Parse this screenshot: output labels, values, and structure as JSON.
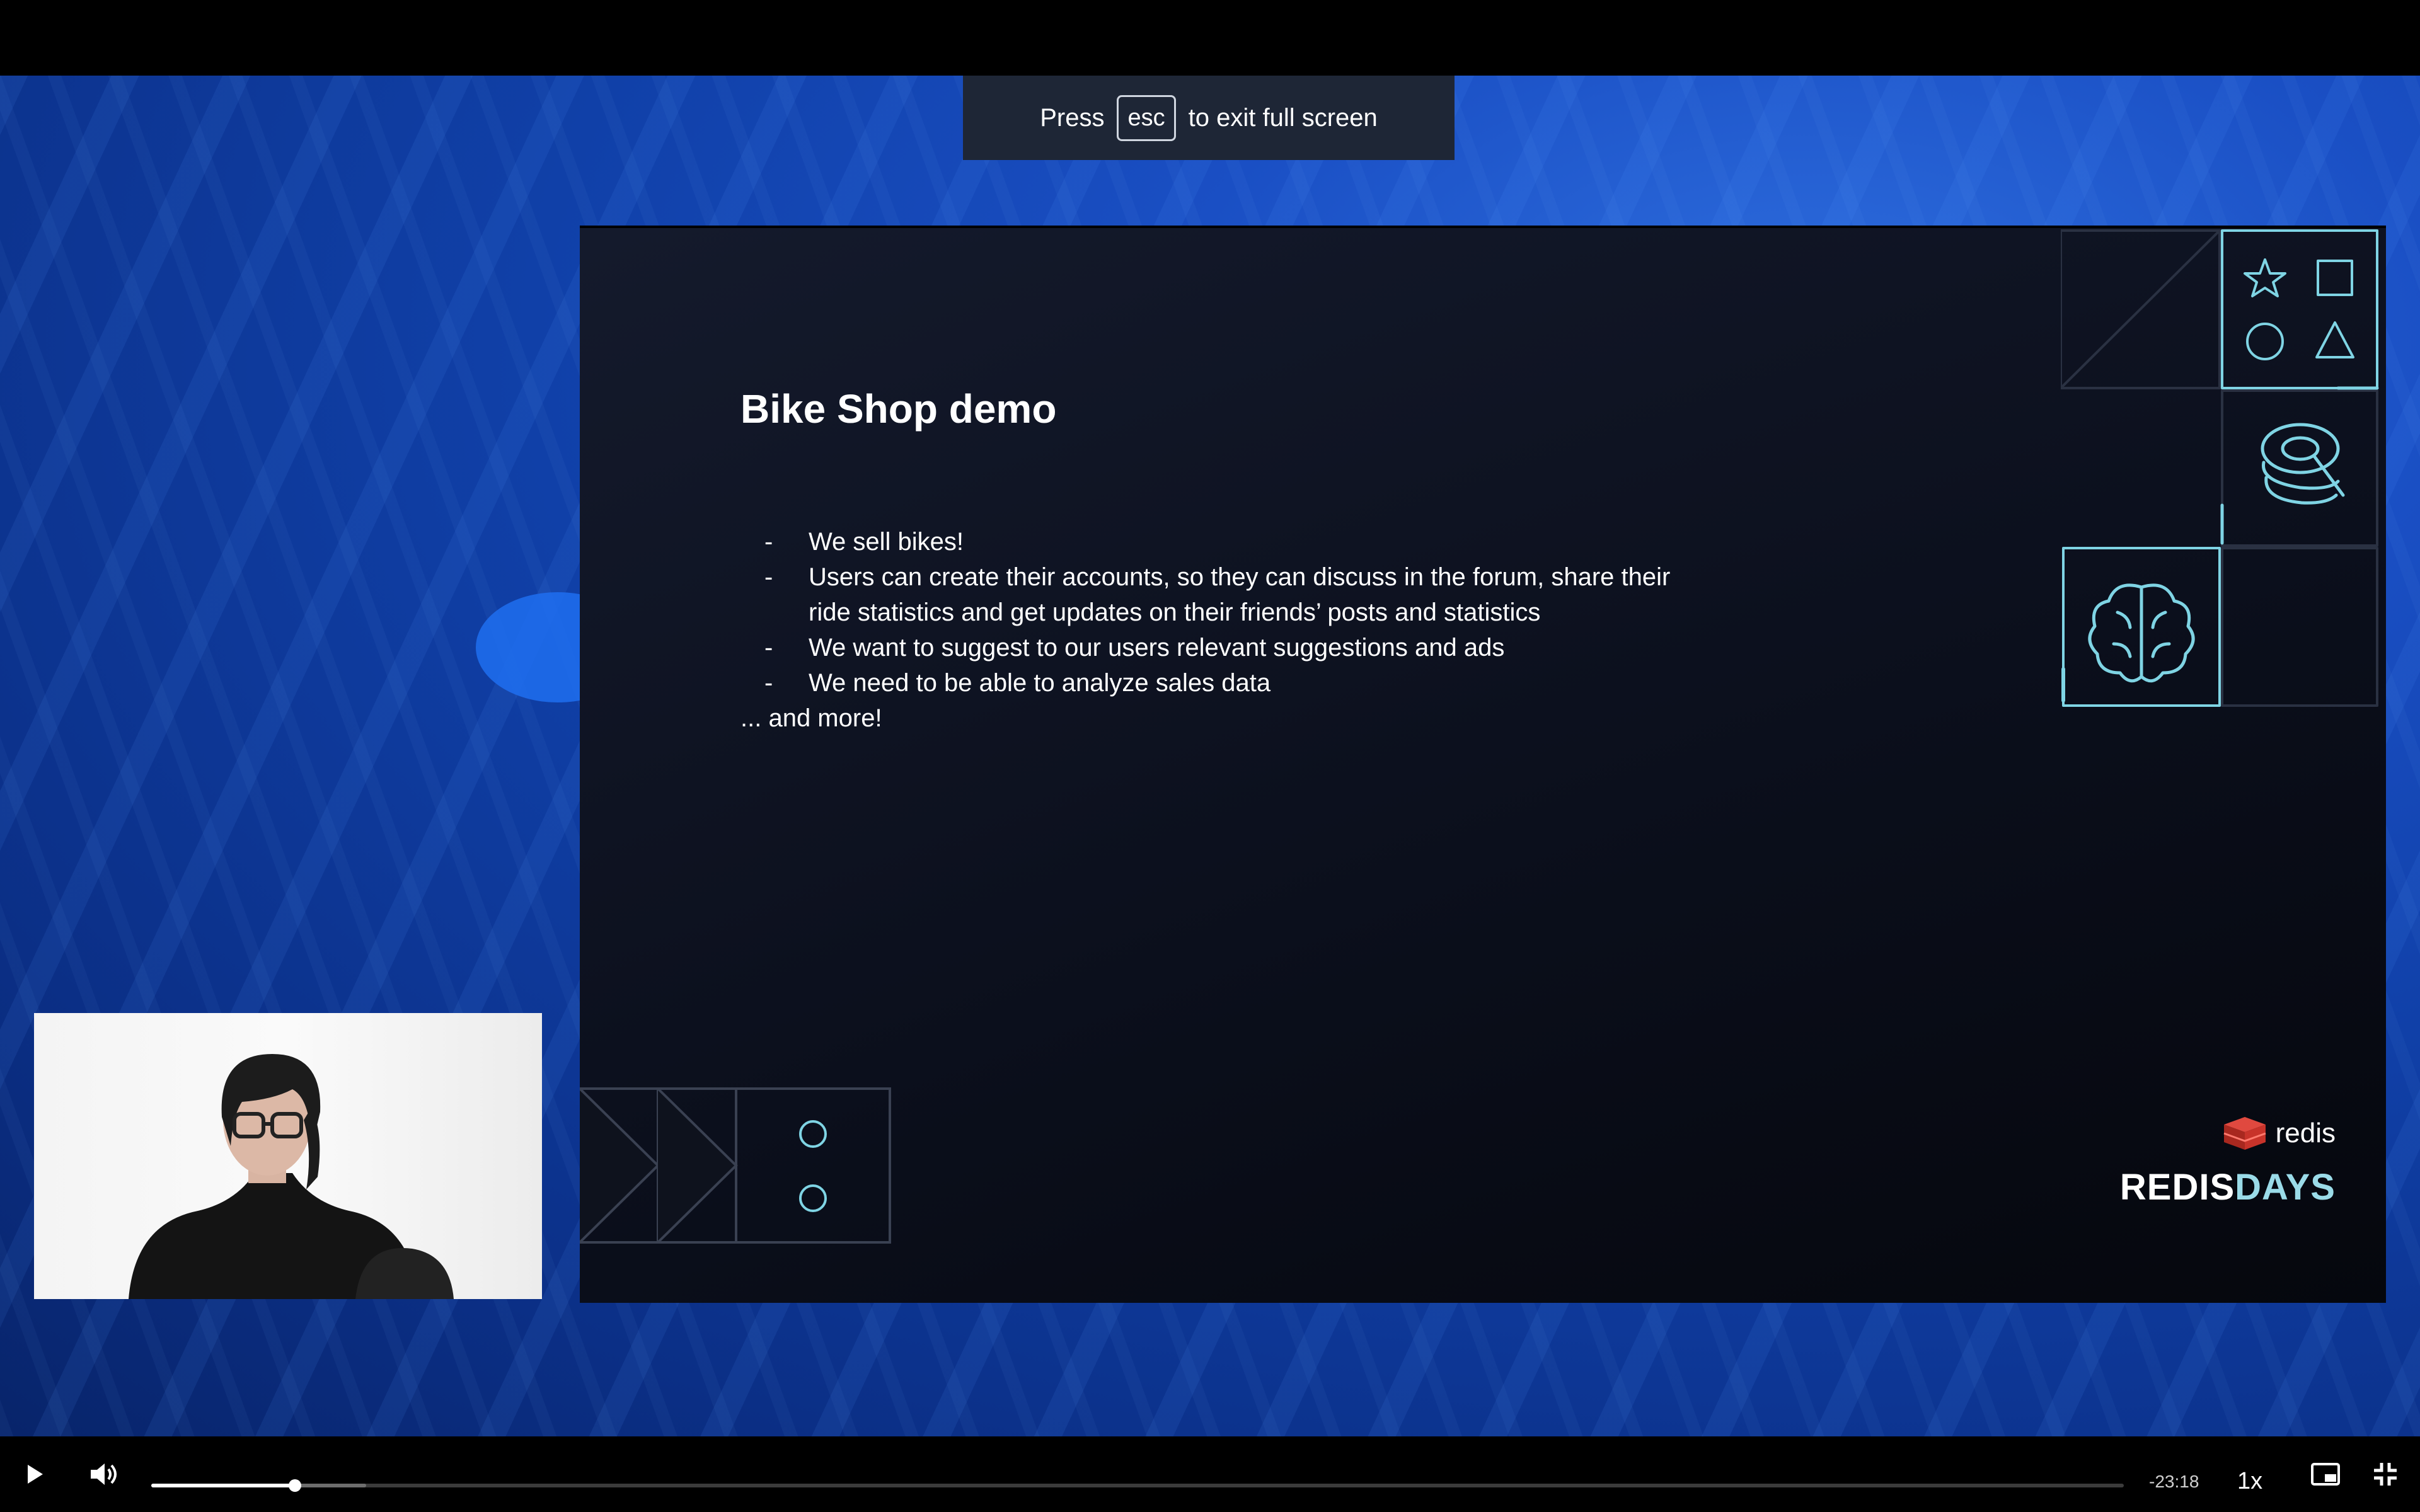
{
  "banner": {
    "press": "Press",
    "key": "esc",
    "suffix": "to exit full screen"
  },
  "slide": {
    "title": "Bike Shop demo",
    "bullets": [
      {
        "dash": "-",
        "text": "We sell bikes!"
      },
      {
        "dash": "-",
        "text": "Users can create their accounts, so they can discuss in the forum, share their ride statistics and get updates on their friends’ posts and statistics"
      },
      {
        "dash": "-",
        "text": "We want to suggest to our users relevant suggestions and ads"
      },
      {
        "dash": "-",
        "text": "We need to be able to analyze sales data"
      }
    ],
    "more": "... and more!",
    "brand": {
      "logo_text": "redis",
      "event_a": "REDIS",
      "event_b": "DAYS"
    }
  },
  "player": {
    "time_remaining": "-23:18",
    "speed": "1x",
    "progress_fraction": 0.073,
    "buffered_fraction": 0.109
  },
  "colors": {
    "accent_cyan": "#7fd4e4",
    "background_blue": "#1040a8"
  }
}
